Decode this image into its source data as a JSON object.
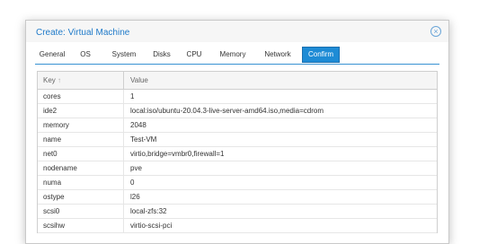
{
  "dialog": {
    "title": "Create: Virtual Machine",
    "close_icon": "close-circle-icon"
  },
  "tabs": [
    {
      "label": "General"
    },
    {
      "label": "OS"
    },
    {
      "label": "System"
    },
    {
      "label": "Disks"
    },
    {
      "label": "CPU"
    },
    {
      "label": "Memory"
    },
    {
      "label": "Network"
    },
    {
      "label": "Confirm",
      "active": true
    }
  ],
  "grid": {
    "columns": {
      "key": "Key",
      "value": "Value",
      "sort_icon": "sort-up-icon"
    },
    "rows": [
      {
        "key": "cores",
        "value": "1"
      },
      {
        "key": "ide2",
        "value": "local:iso/ubuntu-20.04.3-live-server-amd64.iso,media=cdrom"
      },
      {
        "key": "memory",
        "value": "2048"
      },
      {
        "key": "name",
        "value": "Test-VM"
      },
      {
        "key": "net0",
        "value": "virtio,bridge=vmbr0,firewall=1"
      },
      {
        "key": "nodename",
        "value": "pve"
      },
      {
        "key": "numa",
        "value": "0"
      },
      {
        "key": "ostype",
        "value": "l26"
      },
      {
        "key": "scsi0",
        "value": "local-zfs:32"
      },
      {
        "key": "scsihw",
        "value": "virtio-scsi-pci"
      }
    ]
  },
  "colors": {
    "accent": "#1e8bd5",
    "title": "#1f7ac9"
  }
}
